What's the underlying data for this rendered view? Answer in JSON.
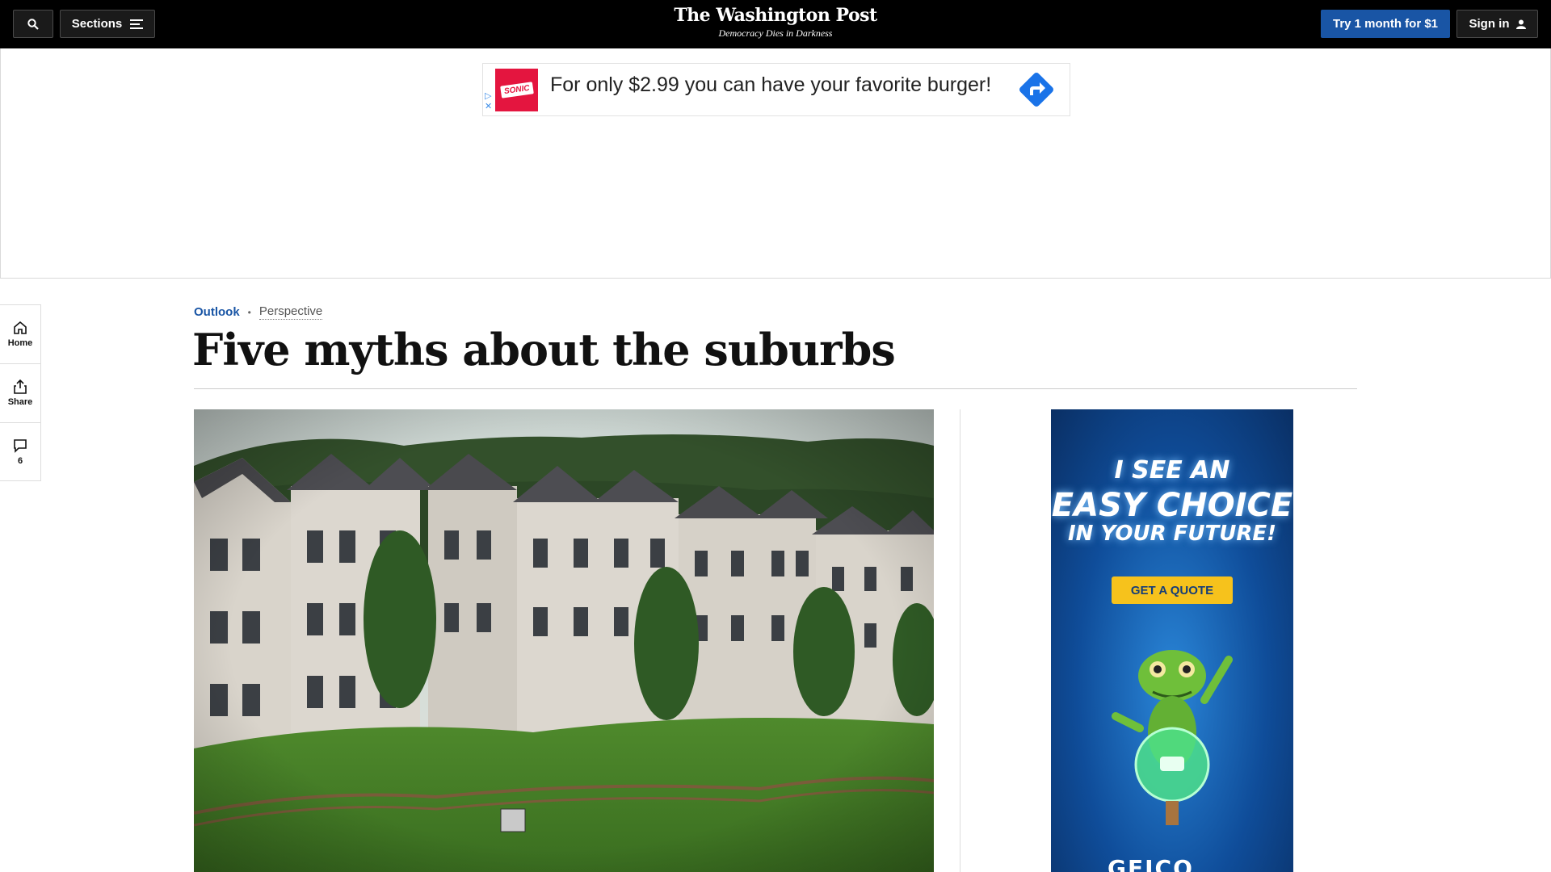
{
  "topbar": {
    "search_icon": "search-icon",
    "sections_label": "Sections",
    "sections_icon": "hamburger-menu-icon",
    "masthead_title": "The Washington Post",
    "masthead_tagline": "Democracy Dies in Darkness",
    "try_label": "Try 1 month for $1",
    "signin_label": "Sign in",
    "signin_icon": "user-icon",
    "accent_color": "#1955a5"
  },
  "banner_ad": {
    "brand_logo": "SONIC",
    "text": "For only $2.99 you can have your favorite burger!",
    "arrow_icon": "directions-arrow-icon"
  },
  "rail": {
    "home_label": "Home",
    "share_label": "Share",
    "comments_count": "6"
  },
  "article": {
    "section": "Outlook",
    "label": "Perspective",
    "headline": "Five myths about the suburbs"
  },
  "side_ad": {
    "line1": "I SEE AN",
    "line2": "EASY CHOICE",
    "line3": "IN YOUR FUTURE!",
    "cta": "GET A QUOTE",
    "brand": "GEICO"
  }
}
